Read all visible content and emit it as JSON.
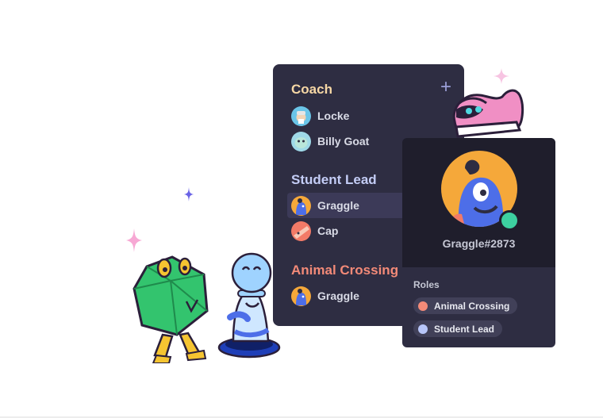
{
  "member_list": {
    "add_icon": "plus-icon",
    "groups": [
      {
        "role": "Coach",
        "color": "#f6d7a5",
        "members": [
          {
            "name": "Locke",
            "avatar_color": "#6ac5e8"
          },
          {
            "name": "Billy Goat",
            "avatar_color": "#9fd9e8"
          }
        ]
      },
      {
        "role": "Student Lead",
        "color": "#c4cdf6",
        "members": [
          {
            "name": "Graggle",
            "avatar_color": "#f5a83a",
            "selected": true
          },
          {
            "name": "Cap",
            "avatar_color": "#f27a67"
          }
        ]
      },
      {
        "role": "Animal Crossing",
        "color": "#f38a78",
        "members": [
          {
            "name": "Graggle",
            "avatar_color": "#f5a83a"
          }
        ]
      }
    ]
  },
  "profile_card": {
    "username": "Graggle#2873",
    "status_color": "#3dd0a0",
    "roles_title": "Roles",
    "roles": [
      {
        "label": "Animal Crossing",
        "color": "#f38a78"
      },
      {
        "label": "Student Lead",
        "color": "#b8c6f9"
      }
    ]
  },
  "decor": {
    "sparkle_colors": [
      "#f7a8d4",
      "#6a63e6",
      "#f7a8d4"
    ]
  }
}
